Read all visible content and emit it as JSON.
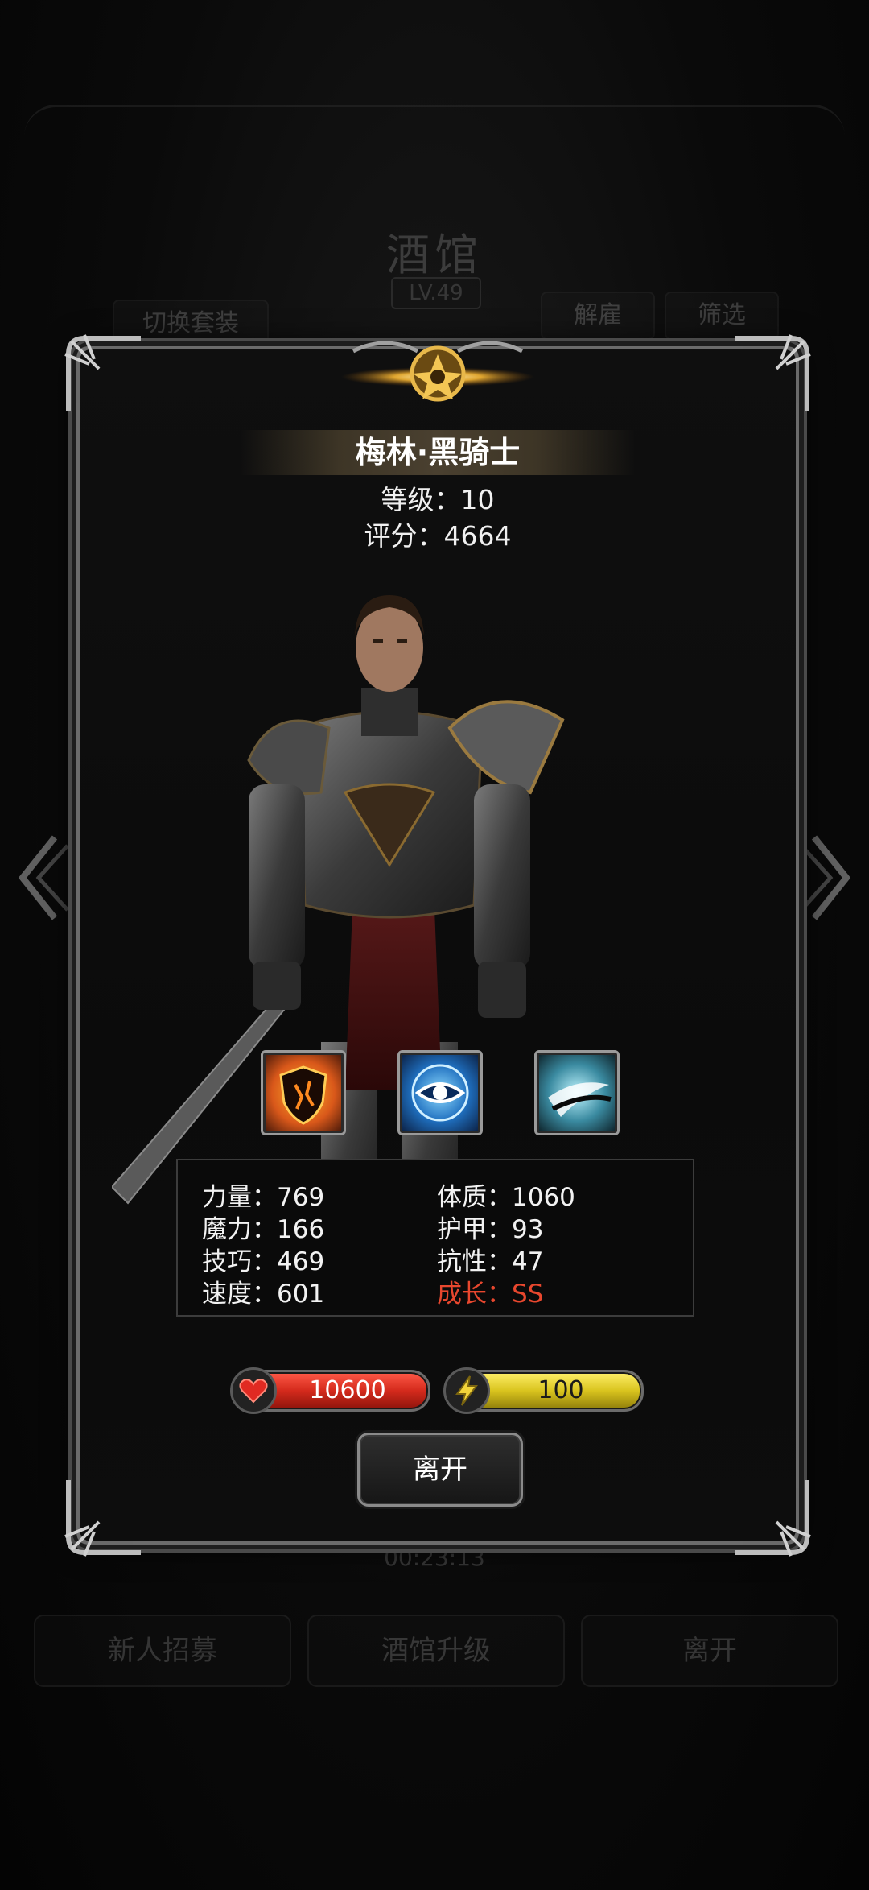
{
  "background": {
    "title": "酒馆",
    "level": "LV.49",
    "switch_outfit_label": "切换套装",
    "dismiss_label": "解雇",
    "filter_label": "筛选",
    "timer": "00:23:13",
    "bottom_buttons": [
      "新人招募",
      "酒馆升级",
      "离开"
    ]
  },
  "hero": {
    "name": "梅林·黑骑士",
    "level_line": "等级：10",
    "score_line": "评分：4664"
  },
  "skills": [
    {
      "icon": "fire-shield-icon"
    },
    {
      "icon": "eye-icon"
    },
    {
      "icon": "slash-icon"
    }
  ],
  "stats": {
    "strength": "力量：769",
    "magic": "魔力：166",
    "skill": "技巧：469",
    "speed": "速度：601",
    "constitution": "体质：1060",
    "armor": "护甲：93",
    "resistance": "抗性：47",
    "growth": "成长：SS"
  },
  "bars": {
    "hp": "10600",
    "energy": "100"
  },
  "leave_label": "离开",
  "colors": {
    "growth": "#e8472e",
    "hp": "#d42a1c",
    "energy": "#d9c41e"
  }
}
